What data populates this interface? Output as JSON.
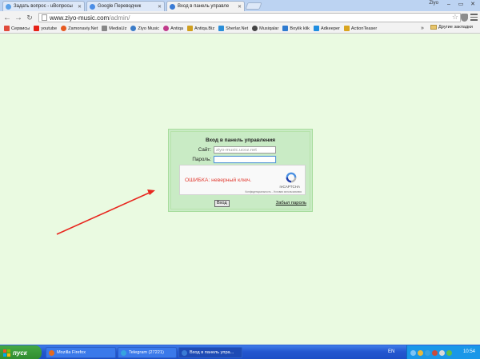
{
  "browser": {
    "tabs": [
      {
        "label": "Задать вопрос - uBопросы",
        "color": "#5aa0e8"
      },
      {
        "label": "Google Переводчик",
        "color": "#4c8ee6"
      },
      {
        "label": "Вход в панель управле",
        "color": "#3a7bd5"
      }
    ],
    "user_name": "ZIyo",
    "address_host": "www.ziyo-music.com",
    "address_path": "/admin/",
    "bookmarks": [
      {
        "label": "Сервисы",
        "color": "#e04a3c"
      },
      {
        "label": "youtube",
        "color": "#e62117"
      },
      {
        "label": "Zamonaviy.Net",
        "color": "#e65a20"
      },
      {
        "label": "MediaUz",
        "color": "#888888"
      },
      {
        "label": "Ziyo Music",
        "color": "#3b7cc8"
      },
      {
        "label": "Antiqa",
        "color": "#c03a8a"
      },
      {
        "label": "Antiqa.Biz",
        "color": "#d0a020"
      },
      {
        "label": "Sherlar.Net",
        "color": "#2b8fd9"
      },
      {
        "label": "Musiqalar",
        "color": "#444444"
      },
      {
        "label": "Boylik klik",
        "color": "#2f7bd0"
      },
      {
        "label": "Adkeeper",
        "color": "#1f8de0"
      },
      {
        "label": "ActionTeaser",
        "color": "#d9a520"
      }
    ],
    "bookmarks_more": "»",
    "other_bookmarks": "Другие закладки"
  },
  "login": {
    "title": "Вход в панель управления",
    "site_label": "Сайт:",
    "site_value": "ziyo-music.ucoz.net",
    "password_label": "Пароль:",
    "password_value": "",
    "captcha_error": "ОШИБКА: неверный ключ.",
    "captcha_brand": "reCAPTCHA",
    "captcha_terms": "Конфиденциальность - Условия использования",
    "submit_label": "Вход",
    "forgot_label": "Забыл пароль"
  },
  "taskbar": {
    "start_label": "пуск",
    "tasks": [
      {
        "label": "Mozilla Firefox",
        "color": "#e66a1e"
      },
      {
        "label": "Telegram (27221)",
        "color": "#36a3e0"
      },
      {
        "label": "Вход в панель упра...",
        "color": "#3a7bd5"
      }
    ],
    "language": "EN",
    "time": "10:54"
  }
}
